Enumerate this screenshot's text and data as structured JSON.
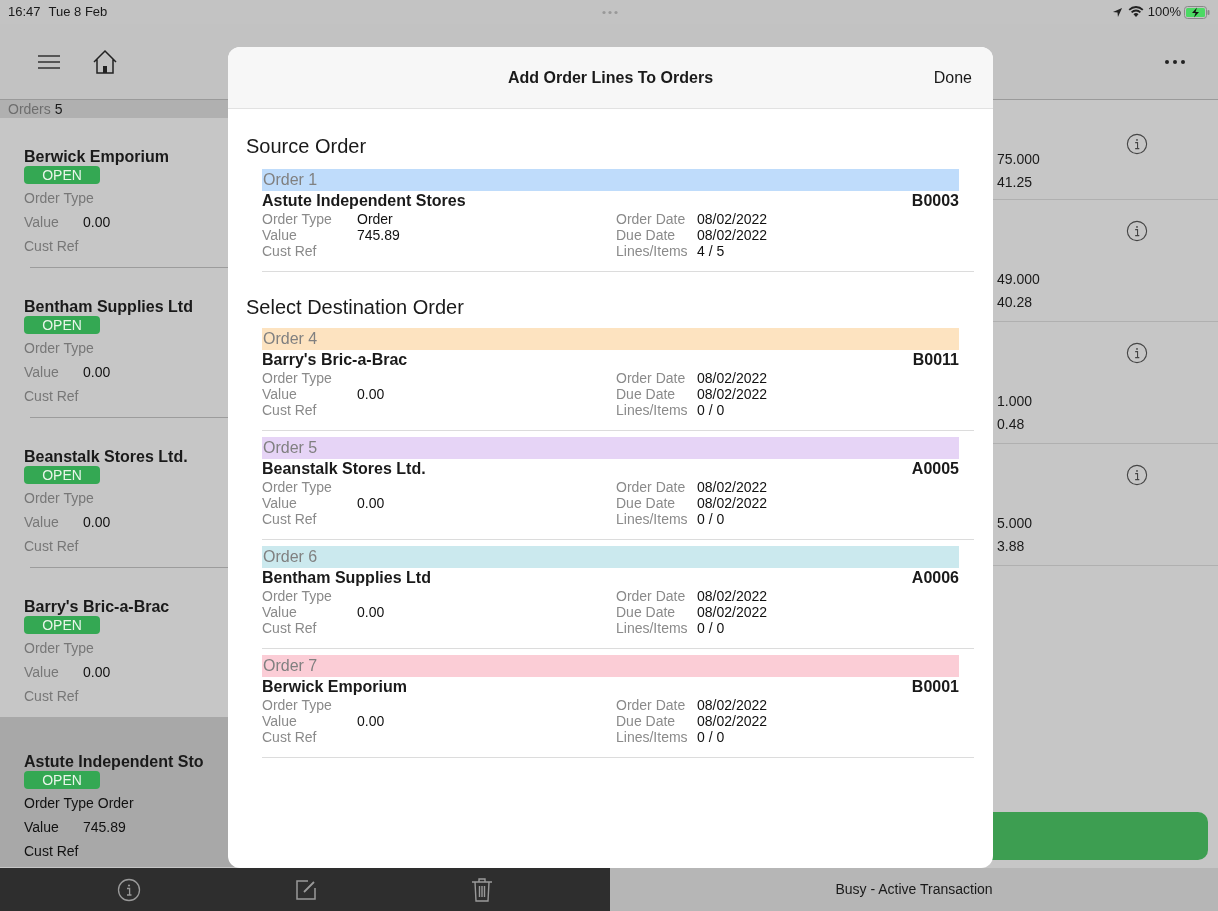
{
  "status_bar": {
    "time": "16:47",
    "date": "Tue 8 Feb",
    "battery": "100%"
  },
  "sidebar": {
    "orders_label": "Orders",
    "orders_count": "5",
    "items": [
      {
        "name": "Berwick Emporium",
        "status": "OPEN",
        "order_type_label": "Order Type",
        "value_label": "Value",
        "value": "0.00",
        "cust_ref_label": "Cust Ref",
        "selected": false
      },
      {
        "name": "Bentham Supplies Ltd",
        "status": "OPEN",
        "order_type_label": "Order Type",
        "value_label": "Value",
        "value": "0.00",
        "cust_ref_label": "Cust Ref",
        "selected": false
      },
      {
        "name": "Beanstalk Stores Ltd.",
        "status": "OPEN",
        "order_type_label": "Order Type",
        "value_label": "Value",
        "value": "0.00",
        "cust_ref_label": "Cust Ref",
        "selected": false
      },
      {
        "name": "Barry's Bric-a-Brac",
        "status": "OPEN",
        "order_type_label": "Order Type",
        "value_label": "Value",
        "value": "0.00",
        "cust_ref_label": "Cust Ref",
        "selected": false
      },
      {
        "name": "Astute Independent Sto",
        "status": "OPEN",
        "order_type_label": "Order Type",
        "order_type": "Order",
        "value_label": "Value",
        "value": "745.89",
        "cust_ref_label": "Cust Ref",
        "selected": true
      }
    ]
  },
  "detail_rows": [
    {
      "quantity": "75.000",
      "value": "41.25"
    },
    {
      "quantity": "49.000",
      "value": "40.28"
    },
    {
      "quantity": "1.000",
      "value": "0.48"
    },
    {
      "quantity": "5.000",
      "value": "3.88"
    }
  ],
  "bottom_bar": {
    "status": "Busy - Active Transaction"
  },
  "modal": {
    "title": "Add Order Lines To Orders",
    "done": "Done",
    "source_heading": "Source Order",
    "source_order": {
      "header": "Order 1",
      "color": "#bfdcfb",
      "customer": "Astute Independent Stores",
      "code": "B0003",
      "order_type_label": "Order Type",
      "order_type": "Order",
      "value_label": "Value",
      "value": "745.89",
      "cust_ref_label": "Cust Ref",
      "order_date_label": "Order Date",
      "order_date": "08/02/2022",
      "due_date_label": "Due Date",
      "due_date": "08/02/2022",
      "lines_label": "Lines/Items",
      "lines": "4 / 5"
    },
    "destination_heading": "Select Destination Order",
    "destination_orders": [
      {
        "header": "Order 4",
        "color": "#fde3c0",
        "customer": "Barry's Bric-a-Brac",
        "code": "B0011",
        "order_type_label": "Order Type",
        "value_label": "Value",
        "value": "0.00",
        "cust_ref_label": "Cust Ref",
        "order_date_label": "Order Date",
        "order_date": "08/02/2022",
        "due_date_label": "Due Date",
        "due_date": "08/02/2022",
        "lines_label": "Lines/Items",
        "lines": "0 / 0"
      },
      {
        "header": "Order 5",
        "color": "#e6d4f6",
        "customer": "Beanstalk Stores Ltd.",
        "code": "A0005",
        "order_type_label": "Order Type",
        "value_label": "Value",
        "value": "0.00",
        "cust_ref_label": "Cust Ref",
        "order_date_label": "Order Date",
        "order_date": "08/02/2022",
        "due_date_label": "Due Date",
        "due_date": "08/02/2022",
        "lines_label": "Lines/Items",
        "lines": "0 / 0"
      },
      {
        "header": "Order 6",
        "color": "#cbe9ee",
        "customer": "Bentham Supplies Ltd",
        "code": "A0006",
        "order_type_label": "Order Type",
        "value_label": "Value",
        "value": "0.00",
        "cust_ref_label": "Cust Ref",
        "order_date_label": "Order Date",
        "order_date": "08/02/2022",
        "due_date_label": "Due Date",
        "due_date": "08/02/2022",
        "lines_label": "Lines/Items",
        "lines": "0 / 0"
      },
      {
        "header": "Order 7",
        "color": "#fbcdd6",
        "customer": "Berwick Emporium",
        "code": "B0001",
        "order_type_label": "Order Type",
        "value_label": "Value",
        "value": "0.00",
        "cust_ref_label": "Cust Ref",
        "order_date_label": "Order Date",
        "order_date": "08/02/2022",
        "due_date_label": "Due Date",
        "due_date": "08/02/2022",
        "lines_label": "Lines/Items",
        "lines": "0 / 0"
      }
    ]
  }
}
